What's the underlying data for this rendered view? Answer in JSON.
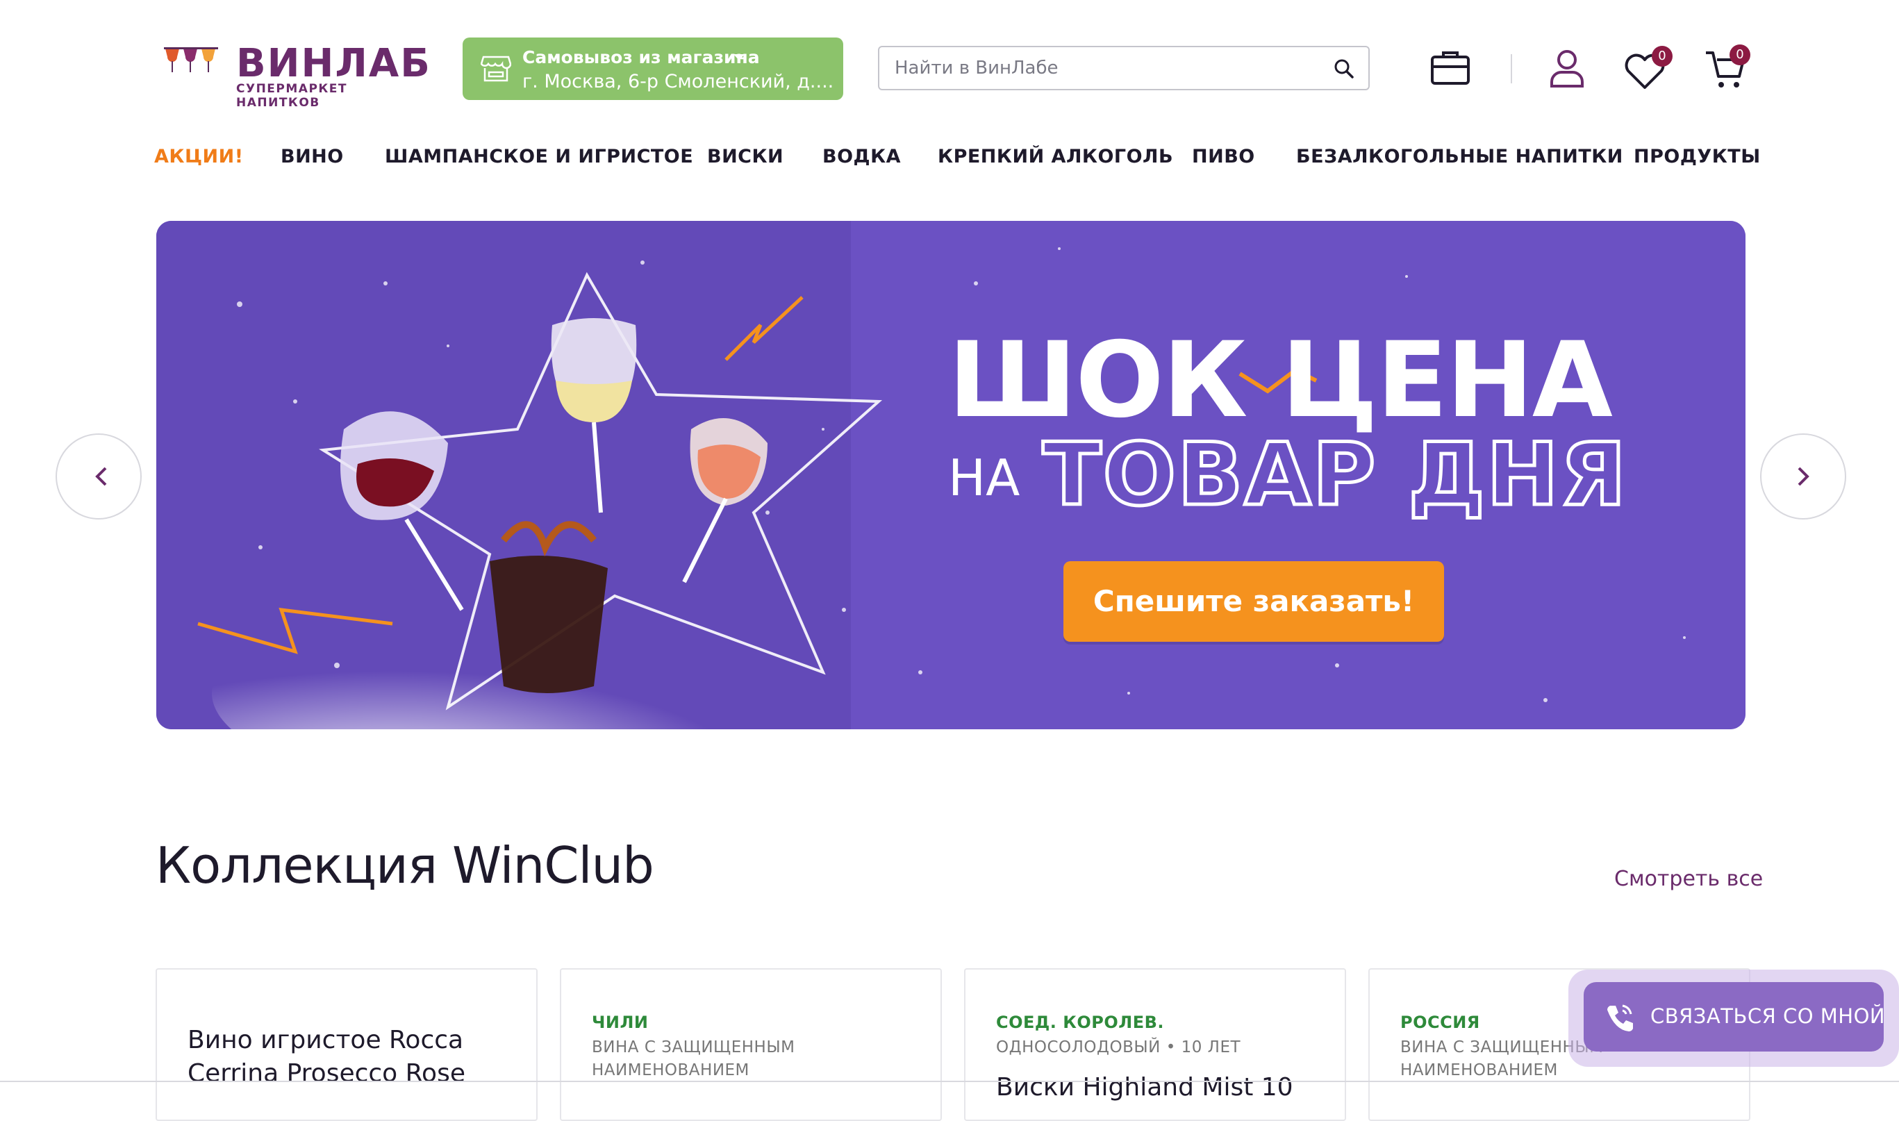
{
  "header": {
    "logo": {
      "title": "ВИНЛАБ",
      "subtitle": "СУПЕРМАРКЕТ НАПИТКОВ"
    },
    "pickup": {
      "title": "Самовывоз из магазина",
      "address": "г. Москва, 6-р Смоленский, д...."
    },
    "search": {
      "placeholder": "Найти в ВинЛабе"
    },
    "icons": [
      "briefcase-icon",
      "user-icon",
      "heart-icon",
      "cart-icon"
    ],
    "favorites_count": "0",
    "cart_count": "0"
  },
  "nav": {
    "items": [
      {
        "label": "АКЦИИ!",
        "accent": true
      },
      {
        "label": "ВИНО"
      },
      {
        "label": "ШАМПАНСКОЕ И ИГРИСТОЕ"
      },
      {
        "label": "ВИСКИ"
      },
      {
        "label": "ВОДКА"
      },
      {
        "label": "КРЕПКИЙ АЛКОГОЛЬ"
      },
      {
        "label": "ПИВО"
      },
      {
        "label": "БЕЗАЛКОГОЛЬНЫЕ НАПИТКИ"
      },
      {
        "label": "ПРОДУКТЫ"
      }
    ]
  },
  "banner": {
    "line1": "ШОК ЦЕНА",
    "line2_prefix": "НА",
    "line2": "ТОВАР ДНЯ",
    "cta": "Спешите заказать!"
  },
  "section": {
    "title": "Коллекция WinClub",
    "see_all": "Смотреть все",
    "cards": [
      {
        "name_lines": [
          "Вино игристое Rocca",
          "Cerrina Prosecco Rose"
        ]
      },
      {
        "country": "ЧИЛИ",
        "category_lines": [
          "ВИНА С ЗАЩИЩЕННЫМ",
          "НАИМЕНОВАНИЕМ"
        ]
      },
      {
        "country": "СОЕД. КОРОЛЕВ.",
        "category_lines": [
          "ОДНОСОЛОДОВЫЙ  •  10 ЛЕТ"
        ],
        "name_partial": "Виски Highland Mist 10"
      },
      {
        "country": "РОССИЯ",
        "category_lines": [
          "ВИНА С ЗАЩИЩЕННЫМ",
          "НАИМЕНОВАНИЕМ"
        ]
      }
    ]
  },
  "contact": {
    "label": "СВЯЗАТЬСЯ СО МНОЙ"
  },
  "colors": {
    "brand": "#6a2b6b",
    "pickup_green": "#8cc36b",
    "accent_orange": "#f07c18",
    "banner_purple": "#6b51c3",
    "cta_orange": "#f5921e",
    "badge": "#8c1a42"
  }
}
